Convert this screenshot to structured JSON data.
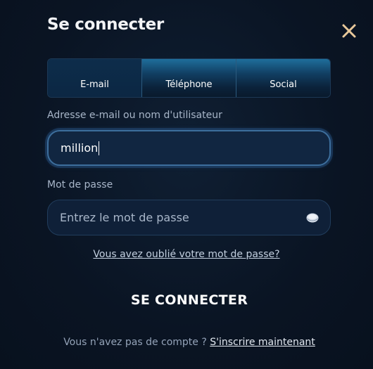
{
  "modal": {
    "title": "Se connecter"
  },
  "tabs": [
    {
      "label": "E-mail",
      "active": true
    },
    {
      "label": "Téléphone",
      "active": false
    },
    {
      "label": "Social",
      "active": false
    }
  ],
  "email": {
    "label": "Adresse e-mail ou nom d'utilisateur",
    "value": "million"
  },
  "password": {
    "label": "Mot de passe",
    "placeholder": "Entrez le mot de passe",
    "icon": "eye-icon"
  },
  "forgot_link": "Vous avez oublié votre mot de passe?",
  "submit_label": "SE CONNECTER",
  "signup": {
    "prompt": "Vous n'avez pas de compte ? ",
    "link": "S'inscrire maintenant"
  },
  "colors": {
    "background": "#0b1626",
    "tab_highlight": "#1f6e9b",
    "close_icon": "#e8c89a"
  }
}
